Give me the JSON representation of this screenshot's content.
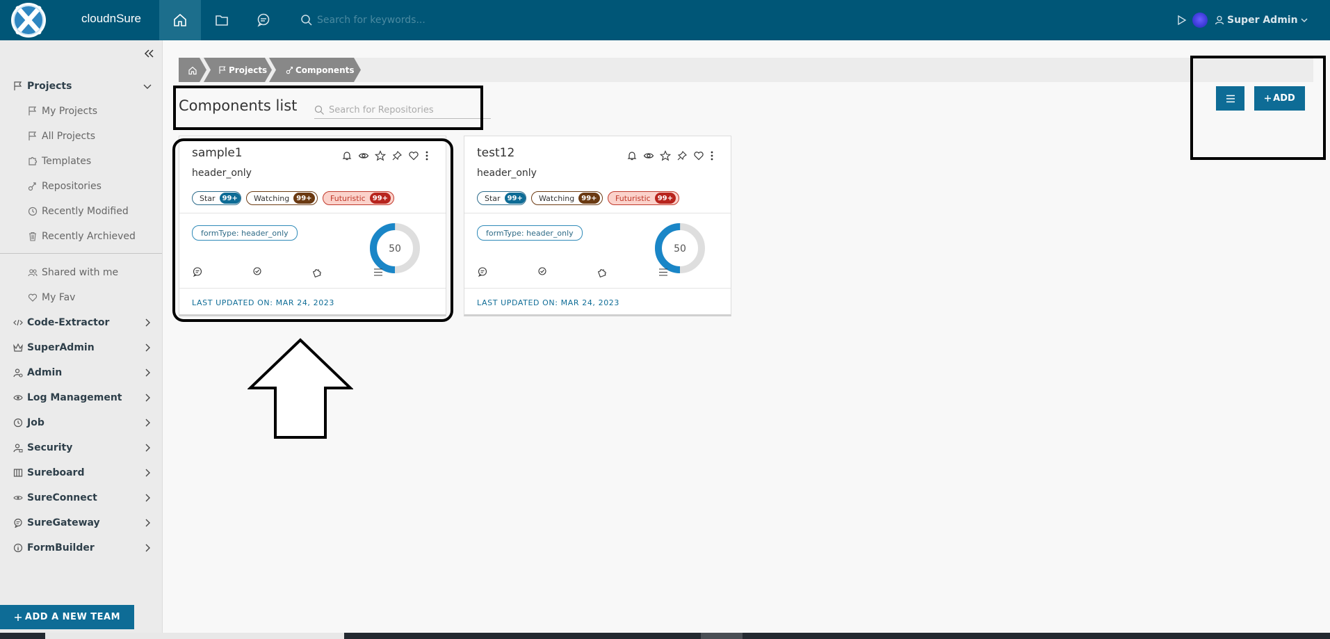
{
  "header": {
    "app_name": "cloudnSure",
    "search_placeholder": "Search for keywords...",
    "user_name": "Super Admin",
    "icons": [
      "home-icon",
      "folder-icon",
      "chat-icon",
      "search-icon",
      "play-icon",
      "user-icon",
      "chevron-down-icon"
    ]
  },
  "sidebar": {
    "items": [
      {
        "label": "Projects",
        "icon": "flag-icon",
        "level": "top",
        "expanded": true
      },
      {
        "label": "My Projects",
        "icon": "flag-icon",
        "level": "sub"
      },
      {
        "label": "All Projects",
        "icon": "flag-icon",
        "level": "sub"
      },
      {
        "label": "Templates",
        "icon": "puzzle-icon",
        "level": "sub"
      },
      {
        "label": "Repositories",
        "icon": "repo-icon",
        "level": "sub"
      },
      {
        "label": "Recently Modified",
        "icon": "clock-icon",
        "level": "sub"
      },
      {
        "label": "Recently Archieved",
        "icon": "trash-icon",
        "level": "sub"
      },
      {
        "label": "Shared with me",
        "icon": "users-icon",
        "level": "sub"
      },
      {
        "label": "My Fav",
        "icon": "heart-icon",
        "level": "sub"
      },
      {
        "label": "Code-Extractor",
        "icon": "code-icon",
        "level": "top"
      },
      {
        "label": "SuperAdmin",
        "icon": "crown-icon",
        "level": "top"
      },
      {
        "label": "Admin",
        "icon": "admin-icon",
        "level": "top"
      },
      {
        "label": "Log Management",
        "icon": "eye-icon",
        "level": "top"
      },
      {
        "label": "Job",
        "icon": "clock-icon",
        "level": "top"
      },
      {
        "label": "Security",
        "icon": "user-lock-icon",
        "level": "top"
      },
      {
        "label": "Sureboard",
        "icon": "board-icon",
        "level": "top"
      },
      {
        "label": "SureConnect",
        "icon": "connect-icon",
        "level": "top"
      },
      {
        "label": "SureGateway",
        "icon": "gateway-icon",
        "level": "top"
      },
      {
        "label": "FormBuilder",
        "icon": "info-icon",
        "level": "top"
      }
    ],
    "add_team_label": "ADD A NEW TEAM"
  },
  "breadcrumb": [
    "Projects",
    "Components"
  ],
  "main": {
    "title": "Components list",
    "search_placeholder": "Search for Repositories",
    "add_label": "ADD"
  },
  "cards": [
    {
      "title": "sample1",
      "subtitle": "header_only",
      "badges": [
        {
          "label": "Star",
          "count": "99+"
        },
        {
          "label": "Watching",
          "count": "99+"
        },
        {
          "label": "Futuristic",
          "count": "99+"
        }
      ],
      "form_type": "formType: header_only",
      "progress": 50,
      "progress_label": "50",
      "footer": "LAST UPDATED ON: MAR 24, 2023"
    },
    {
      "title": "test12",
      "subtitle": "header_only",
      "badges": [
        {
          "label": "Star",
          "count": "99+"
        },
        {
          "label": "Watching",
          "count": "99+"
        },
        {
          "label": "Futuristic",
          "count": "99+"
        }
      ],
      "form_type": "formType: header_only",
      "progress": 50,
      "progress_label": "50",
      "footer": "LAST UPDATED ON: MAR 24, 2023"
    }
  ],
  "colors": {
    "header_bg": "#005677",
    "primary_button": "#0e6c96",
    "star_badge": "#0e6c96",
    "watching_badge": "#6b3a12",
    "futuristic_badge": "#b8251e",
    "futuristic_bg": "#fbd2cb",
    "donut_fill": "#1a86c7"
  }
}
